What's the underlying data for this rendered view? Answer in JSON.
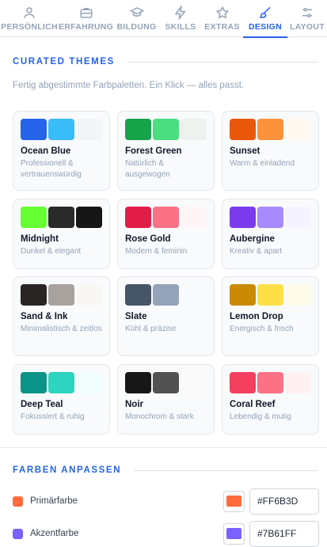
{
  "tabs": [
    {
      "label": "PERSÖNLICH",
      "icon": "user-icon"
    },
    {
      "label": "ERFAHRUNG",
      "icon": "briefcase-icon"
    },
    {
      "label": "BILDUNG",
      "icon": "graduation-cap-icon"
    },
    {
      "label": "SKILLS",
      "icon": "lightning-icon"
    },
    {
      "label": "EXTRAS",
      "icon": "star-icon"
    },
    {
      "label": "DESIGN",
      "icon": "brush-icon",
      "active": true
    },
    {
      "label": "LAYOUT",
      "icon": "sliders-icon"
    }
  ],
  "curated": {
    "title": "CURATED THEMES",
    "subtitle": "Fertig abgestimmte Farbpaletten. Ein Klick — alles passt.",
    "themes": [
      {
        "name": "Ocean Blue",
        "desc": "Professionell & vertrauenswürdig",
        "colors": [
          "#2563eb",
          "#38bdf8",
          "#f3f4f6"
        ]
      },
      {
        "name": "Forest Green",
        "desc": "Natürlich & ausgewogen",
        "colors": [
          "#16a34a",
          "#4ade80",
          "#eef2ee"
        ]
      },
      {
        "name": "Sunset",
        "desc": "Warm & einladend",
        "colors": [
          "#ea580c",
          "#fb923c",
          "#fff7f0"
        ]
      },
      {
        "name": "Midnight",
        "desc": "Dunkel & elegant",
        "colors": [
          "#65ff33",
          "#2a2a2a",
          "#161616"
        ]
      },
      {
        "name": "Rose Gold",
        "desc": "Modern & feminin",
        "colors": [
          "#e11d48",
          "#fb7185",
          "#fff5f7"
        ]
      },
      {
        "name": "Aubergine",
        "desc": "Kreativ & apart",
        "colors": [
          "#7c3aed",
          "#a78bfa",
          "#f5f3ff"
        ]
      },
      {
        "name": "Sand & Ink",
        "desc": "Minimalistisch & zeitlos",
        "colors": [
          "#292524",
          "#a8a29e",
          "#f8f7f4"
        ]
      },
      {
        "name": "Slate",
        "desc": "Kühl & präzise",
        "colors": [
          "#475569",
          "#94a3b8",
          "#f8fafc"
        ]
      },
      {
        "name": "Lemon Drop",
        "desc": "Energisch & frisch",
        "colors": [
          "#ca8a04",
          "#fde047",
          "#fefce8"
        ]
      },
      {
        "name": "Deep Teal",
        "desc": "Fokussiert & ruhig",
        "colors": [
          "#0d9488",
          "#2dd4bf",
          "#f0fdfa"
        ]
      },
      {
        "name": "Noir",
        "desc": "Monochrom & stark",
        "colors": [
          "#171717",
          "#525252",
          "#fafafa"
        ]
      },
      {
        "name": "Coral Reef",
        "desc": "Lebendig & mutig",
        "colors": [
          "#f43f5e",
          "#fb7185",
          "#fff1f2"
        ]
      }
    ]
  },
  "custom": {
    "title": "FARBEN ANPASSEN",
    "rows": [
      {
        "label": "Primärfarbe",
        "color": "#FF6B3D",
        "value": "#FF6B3D"
      },
      {
        "label": "Akzentfarbe",
        "color": "#7B61FF",
        "value": "#7B61FF"
      }
    ]
  }
}
